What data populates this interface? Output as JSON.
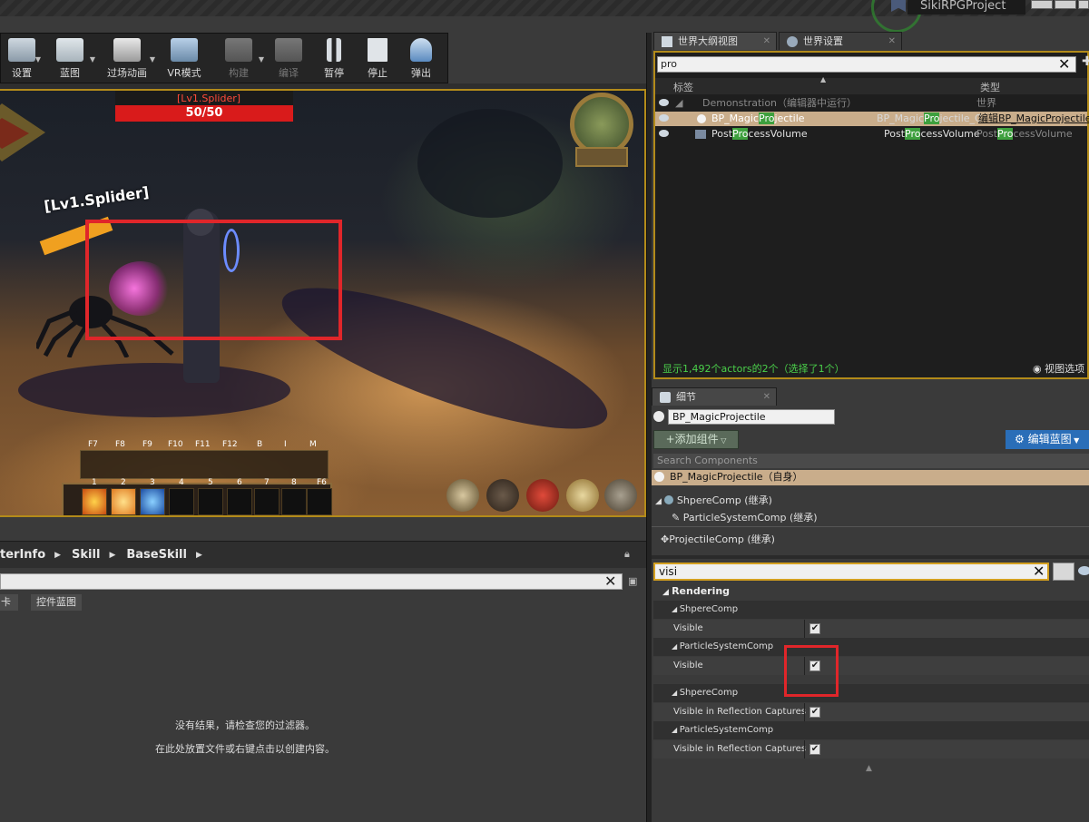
{
  "window": {
    "project_name": "SikiRPGProject"
  },
  "toolbar": {
    "buttons": [
      {
        "label": "设置",
        "enabled": true
      },
      {
        "label": "蓝图",
        "enabled": true
      },
      {
        "label": "过场动画",
        "enabled": true
      },
      {
        "label": "VR模式",
        "enabled": true
      },
      {
        "label": "构建",
        "enabled": false
      },
      {
        "label": "编译",
        "enabled": false
      },
      {
        "label": "暂停",
        "enabled": true
      },
      {
        "label": "停止",
        "enabled": true
      },
      {
        "label": "弹出",
        "enabled": true
      }
    ]
  },
  "viewport": {
    "enemy_name_top": "[Lv1.Splider]",
    "hp_text": "50/50",
    "enemy_name_floating": "[Lv1.Splider]",
    "hotbar_fkeys": [
      "F7",
      "F8",
      "F9",
      "F10",
      "F11",
      "F12",
      "B",
      "I",
      "M"
    ],
    "hotbar_numbers": [
      "1",
      "2",
      "3",
      "4",
      "5",
      "6",
      "7",
      "8",
      "F6"
    ]
  },
  "content_browser": {
    "breadcrumb": [
      "terInfo",
      "Skill",
      "BaseSkill"
    ],
    "tab_partial": "卡",
    "tab_widget_bp": "控件蓝图",
    "empty_line1": "没有结果，请检查您的过滤器。",
    "empty_line2": "在此处放置文件或右键点击以创建内容。"
  },
  "world_outliner": {
    "tab_title": "世界大纲视图",
    "tab_world_settings": "世界设置",
    "search_value": "pro",
    "col_label": "标签",
    "col_type": "类型",
    "rows": [
      {
        "label": "Demonstration（编辑器中运行）",
        "type": "世界",
        "extra": ""
      },
      {
        "label_pre": "BP_Magic",
        "label_hl": "Pro",
        "label_post": "jectile",
        "type_pre": "BP_Magic",
        "type_hl": "Pro",
        "type_post": "jectile_C",
        "extra": "编辑BP_MagicProjectile"
      },
      {
        "label_pre": "Post",
        "label_hl": "Pro",
        "label_post": "cessVolume",
        "type_pre": "Post",
        "type_hl": "Pro",
        "type_post": "cessVolume",
        "extra_pre": "Post",
        "extra_hl": "Pro",
        "extra_post": "cessVolume"
      }
    ],
    "status": "显示1,492个actors的2个（选择了1个）",
    "view_options": "视图选项"
  },
  "details": {
    "tab_title": "细节",
    "actor_name": "BP_MagicProjectile",
    "add_component": "+添加组件",
    "edit_blueprint": "编辑蓝图",
    "component_search_placeholder": "Search Components",
    "self_row": "BP_MagicProjectile（自身）",
    "components": [
      "ShpereComp (继承)",
      "ParticleSystemComp (继承)",
      "ProjectileComp (继承)"
    ],
    "property_search": "visi",
    "category": "Rendering",
    "groups": [
      {
        "component": "ShpereComp",
        "property": "Visible",
        "checked": true
      },
      {
        "component": "ParticleSystemComp",
        "property": "Visible",
        "checked": true
      },
      {
        "component": "ShpereComp",
        "property": "Visible in Reflection Captures",
        "checked": true
      },
      {
        "component": "ParticleSystemComp",
        "property": "Visible in Reflection Captures",
        "checked": true
      }
    ]
  },
  "colors": {
    "highlight_box": "#e0262a",
    "selected_row": "#c9ad8b",
    "search_match": "#3ea03e",
    "edit_blueprint_btn": "#2a6eb8"
  }
}
